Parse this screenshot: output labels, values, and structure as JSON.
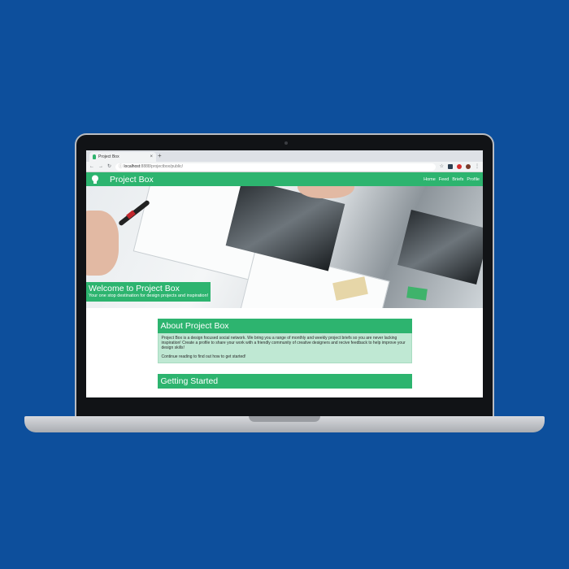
{
  "browser": {
    "tab_title": "Project Box",
    "tab_close": "×",
    "new_tab": "+",
    "url_host": "localhost",
    "url_path": ":8888/projectbox/public/",
    "nav_icons": [
      "back-icon",
      "forward-icon",
      "reload-icon",
      "info-icon"
    ],
    "extension_icons": [
      "star-icon",
      "extension-icon",
      "opera-icon",
      "profile-icon",
      "menu-icon"
    ]
  },
  "site": {
    "brand": "Project Box",
    "logo_icon": "lightbulb-icon",
    "nav_links": [
      "Home",
      "Feed",
      "Briefs",
      "Profile"
    ]
  },
  "hero": {
    "title": "Welcome to Project Box",
    "subtitle": "Your one stop destination for design projects and inspiration!"
  },
  "about": {
    "heading": "About Project Box",
    "paragraph1": "Project Box is a design focused social network. We bring you a range of monthly and weekly project briefs so you are never lacking inspiration! Create a profile to share your work with a friendly community of creative designers and recive feedback to help improve your design skills!",
    "paragraph2": "Continue reading to find out how to get started!"
  },
  "getting_started": {
    "heading": "Getting Started"
  },
  "colors": {
    "background": "#0d4f9c",
    "brand_green": "#2db46f",
    "card_body": "#bfe8d3"
  }
}
